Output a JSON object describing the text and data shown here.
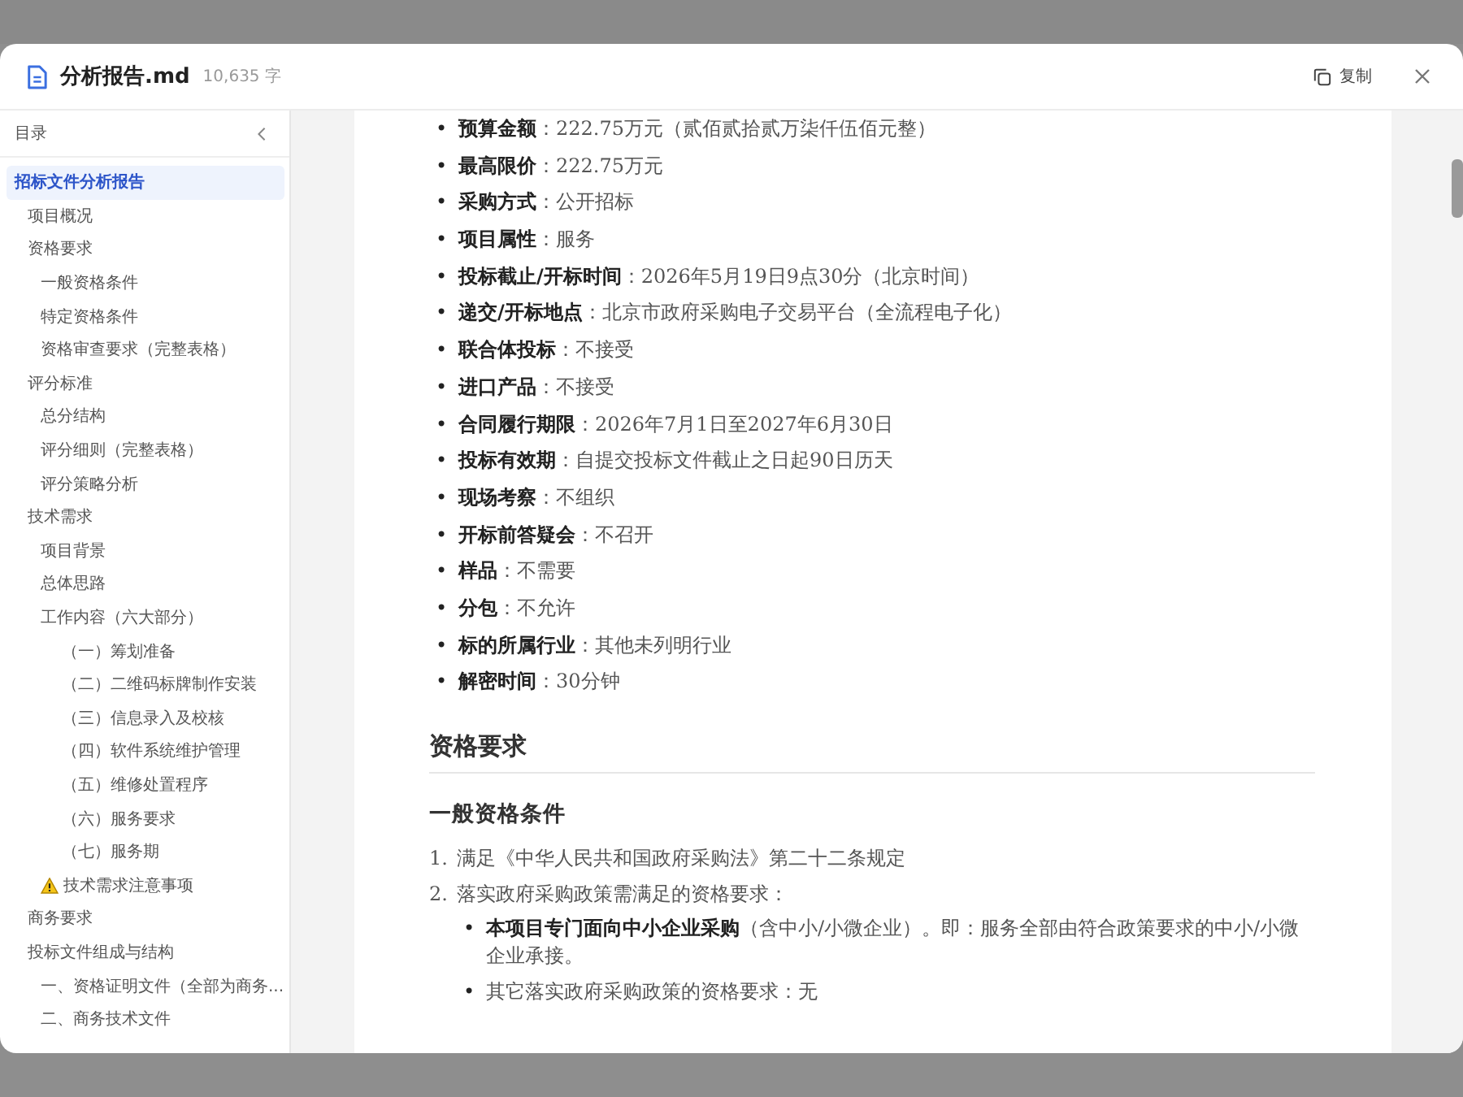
{
  "header": {
    "title": "分析报告.md",
    "word_count": "10,635 字",
    "copy_label": "复制"
  },
  "toc": {
    "title": "目录",
    "items": [
      {
        "label": "招标文件分析报告",
        "selected": true,
        "children": [
          {
            "label": "项目概况",
            "selected": false
          },
          {
            "label": "资格要求",
            "selected": false,
            "children": [
              {
                "label": "一般资格条件",
                "selected": false
              },
              {
                "label": "特定资格条件",
                "selected": false
              },
              {
                "label": "资格审查要求（完整表格）",
                "selected": false
              }
            ]
          },
          {
            "label": "评分标准",
            "selected": false,
            "children": [
              {
                "label": "总分结构",
                "selected": false
              },
              {
                "label": "评分细则（完整表格）",
                "selected": false
              },
              {
                "label": "评分策略分析",
                "selected": false
              }
            ]
          },
          {
            "label": "技术需求",
            "selected": false,
            "children": [
              {
                "label": "项目背景",
                "selected": false
              },
              {
                "label": "总体思路",
                "selected": false
              },
              {
                "label": "工作内容（六大部分）",
                "selected": false,
                "children": [
                  {
                    "label": "（一）筹划准备",
                    "selected": false
                  },
                  {
                    "label": "（二）二维码标牌制作安装",
                    "selected": false
                  },
                  {
                    "label": "（三）信息录入及校核",
                    "selected": false
                  },
                  {
                    "label": "（四）软件系统维护管理",
                    "selected": false
                  },
                  {
                    "label": "（五）维修处置程序",
                    "selected": false
                  },
                  {
                    "label": "（六）服务要求",
                    "selected": false
                  },
                  {
                    "label": "（七）服务期",
                    "selected": false
                  }
                ]
              },
              {
                "label": "技术需求注意事项",
                "selected": false,
                "kind": "warning"
              }
            ]
          },
          {
            "label": "商务要求",
            "selected": false
          },
          {
            "label": "投标文件组成与结构",
            "selected": false,
            "children": [
              {
                "label": "一、资格证明文件（全部为商务...",
                "selected": false
              },
              {
                "label": "二、商务技术文件",
                "selected": false
              }
            ]
          }
        ]
      }
    ]
  },
  "document": {
    "blocks": [
      {
        "kind": "bullets",
        "marker": "•",
        "items": [
          "**预算金额**：222.75万元（贰佰贰拾贰万柒仟伍佰元整）",
          "**最高限价**：222.75万元",
          "**采购方式**：公开招标",
          "**项目属性**：服务",
          "**投标截止/开标时间**：2026年5月19日9点30分（北京时间）",
          "**递交/开标地点**：北京市政府采购电子交易平台（全流程电子化）",
          "**联合体投标**：不接受",
          "**进口产品**：不接受",
          "**合同履行期限**：2026年7月1日至2027年6月30日",
          "**投标有效期**：自提交投标文件截止之日起90日历天",
          "**现场考察**：不组织",
          "**开标前答疑会**：不召开",
          "**样品**：不需要",
          "**分包**：不允许",
          "**标的所属行业**：其他未列明行业",
          "**解密时间**：30分钟"
        ]
      },
      {
        "kind": "h2",
        "text": "资格要求"
      },
      {
        "kind": "h3",
        "text": "一般资格条件"
      },
      {
        "kind": "ordered",
        "items": [
          {
            "number": "1.",
            "text": "满足《中华人民共和国政府采购法》第二十二条规定"
          },
          {
            "number": "2.",
            "text": "落实政府采购政策需满足的资格要求：",
            "marker": "•",
            "children": [
              "**本项目专门面向中小企业采购**（含中小/小微企业）。即：服务全部由符合政策要求的中小/小微企业承接。",
              "其它落实政府采购政策的资格要求：无"
            ]
          }
        ]
      }
    ]
  }
}
